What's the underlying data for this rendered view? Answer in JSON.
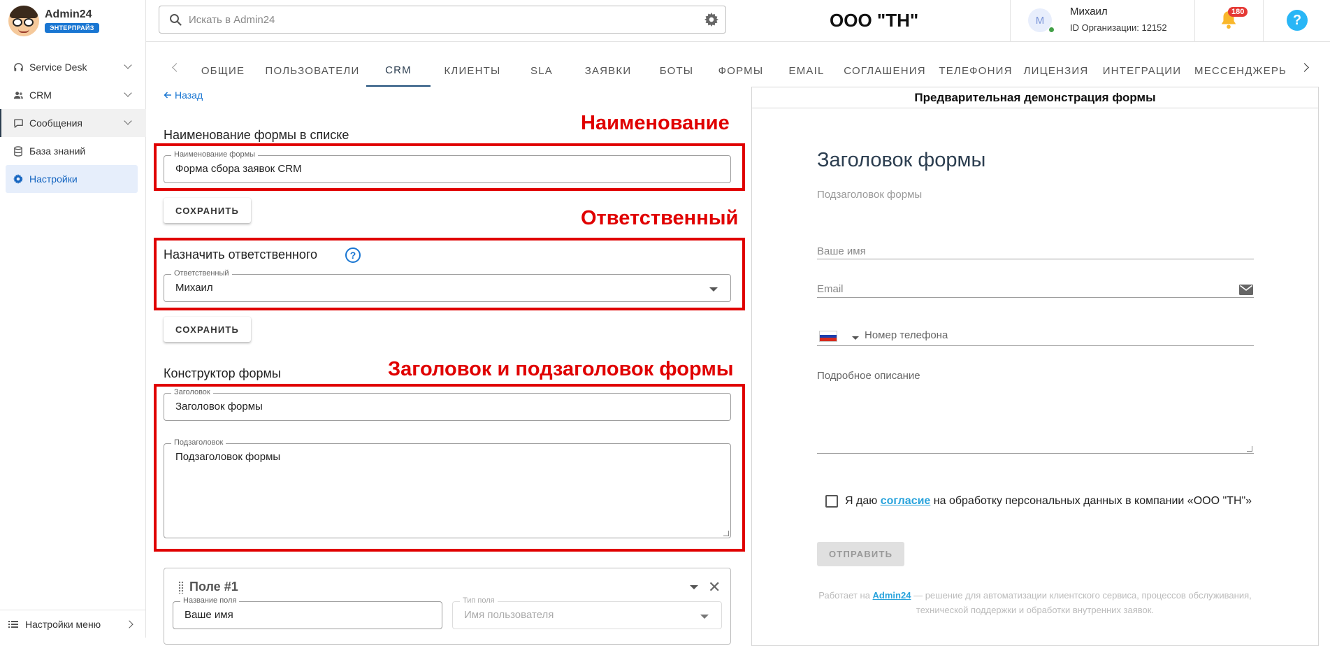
{
  "brand": {
    "name": "Admin24",
    "badge": "ЭНТЕРПРАЙЗ"
  },
  "sidebar": {
    "items": [
      {
        "label": "Service Desk",
        "icon": "headset-icon"
      },
      {
        "label": "CRM",
        "icon": "users-icon"
      },
      {
        "label": "Сообщения",
        "icon": "chat-icon"
      },
      {
        "label": "База знаний",
        "icon": "database-icon"
      },
      {
        "label": "Настройки",
        "icon": "gear-icon"
      }
    ],
    "menu_settings": "Настройки меню"
  },
  "header": {
    "search_placeholder": "Искать в Admin24",
    "org_name": "ООО \"ТН\"",
    "user_initial": "M",
    "user_name": "Михаил",
    "org_id": "ID Организации: 12152",
    "notifications": "180",
    "help": "?"
  },
  "tabs": [
    "ОБЩИЕ",
    "ПОЛЬЗОВАТЕЛИ",
    "CRM",
    "КЛИЕНТЫ",
    "SLA",
    "ЗАЯВКИ",
    "БОТЫ",
    "ФОРМЫ",
    "EMAIL",
    "СОГЛАШЕНИЯ",
    "ТЕЛЕФОНИЯ",
    "ЛИЦЕНЗИЯ",
    "ИНТЕГРАЦИИ",
    "МЕССЕНДЖЕРЫ"
  ],
  "active_tab": "CRM",
  "form": {
    "back": "Назад",
    "name_section": "Наименование формы в списке",
    "name_label": "Наименование формы",
    "name_value": "Форма сбора заявок CRM",
    "save": "СОХРАНИТЬ",
    "responsible_section": "Назначить ответственного",
    "responsible_label": "Ответственный",
    "responsible_value": "Михаил",
    "builder_section": "Конструктор формы",
    "header_label": "Заголовок",
    "header_value": "Заголовок формы",
    "subheader_label": "Подзаголовок",
    "subheader_value": "Подзаголовок формы",
    "field_title": "Поле #1",
    "field_name_label": "Название поля",
    "field_name_value": "Ваше имя",
    "field_type_label": "Тип поля",
    "field_type_value": "Имя пользователя"
  },
  "annotations": {
    "name": "Наименование",
    "responsible": "Ответственный",
    "headers": "Заголовок и подзаголовок формы"
  },
  "preview": {
    "heading": "Предварительная демонстрация формы",
    "title": "Заголовок формы",
    "subtitle": "Подзаголовок формы",
    "name_placeholder": "Ваше имя",
    "email_placeholder": "Email",
    "phone_placeholder": "Номер телефона",
    "description_placeholder": "Подробное описание",
    "consent_before": "Я даю",
    "consent_link": "согласие",
    "consent_after": "на обработку персональных данных в компании «ООО \"ТН\"»",
    "submit": "ОТПРАВИТЬ",
    "footer_before": "Работает на",
    "footer_link": "Admin24",
    "footer_after": "— решение для автоматизации клиентского сервиса, процессов обслуживания, технической поддержки и обработки внутренних заявок."
  },
  "colors": {
    "accent": "#1976d2",
    "annotation": "#e00000",
    "active_nav_bg": "#e6eefb",
    "link": "#29a3dc"
  }
}
